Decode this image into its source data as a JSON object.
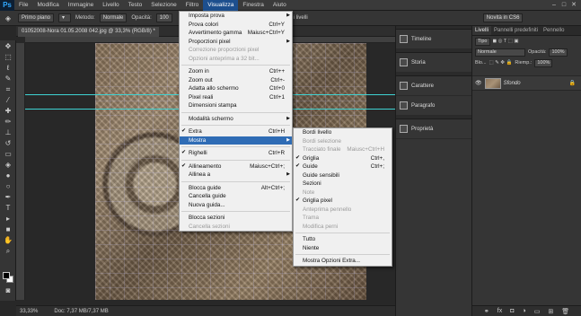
{
  "menubar": {
    "logo": "Ps",
    "items": [
      "File",
      "Modifica",
      "Immagine",
      "Livello",
      "Testo",
      "Selezione",
      "Filtro",
      "Visualizza",
      "Finestra",
      "Aiuto"
    ]
  },
  "optionsbar": {
    "preset": "Primo piano",
    "mode_label": "Metodo:",
    "mode_value": "Normale",
    "opacity_label": "Opacità:",
    "opacity_value": "100",
    "all_layers": "i livelli",
    "workspace": "Novità in CS6"
  },
  "document": {
    "tab_title": "01052008-Nora 01.05.2008 042.jpg @ 33,3% (RGB/8) *"
  },
  "statusbar": {
    "zoom": "33,33%",
    "doc_info": "Doc: 7,37 MB/7,37 MB"
  },
  "collapsed_panels": [
    "Timeline",
    "Storia",
    "Carattere",
    "Paragrafo",
    "Proprietà"
  ],
  "layers_panel": {
    "tabs": [
      "Livelli",
      "Pannelli predefiniti",
      "Pennello"
    ],
    "kind_label": "Tipo",
    "blend_mode": "Normale",
    "opacity_label": "Opacità:",
    "opacity_value": "100%",
    "lock_label": "Blo...",
    "fill_label": "Riemp.:",
    "fill_value": "100%",
    "layer_name": "Sfondo"
  },
  "visualizza_menu": {
    "items": [
      {
        "label": "Imposta prova",
        "shortcut": "",
        "submenu": true,
        "disabled": false
      },
      {
        "label": "Prova colori",
        "shortcut": "Ctrl+Y",
        "submenu": false,
        "disabled": false
      },
      {
        "label": "Avvertimento gamma",
        "shortcut": "Maiusc+Ctrl+Y",
        "submenu": false,
        "disabled": false
      },
      {
        "label": "Proporzioni pixel",
        "shortcut": "",
        "submenu": true,
        "disabled": false
      },
      {
        "label": "Correzione proporzioni pixel",
        "shortcut": "",
        "submenu": false,
        "disabled": true
      },
      {
        "label": "Opzioni anteprima a 32 bit...",
        "shortcut": "",
        "submenu": false,
        "disabled": true
      },
      {
        "sep": true
      },
      {
        "label": "Zoom in",
        "shortcut": "Ctrl++",
        "submenu": false,
        "disabled": false
      },
      {
        "label": "Zoom out",
        "shortcut": "Ctrl+-",
        "submenu": false,
        "disabled": false
      },
      {
        "label": "Adatta allo schermo",
        "shortcut": "Ctrl+0",
        "submenu": false,
        "disabled": false
      },
      {
        "label": "Pixel reali",
        "shortcut": "Ctrl+1",
        "submenu": false,
        "disabled": false
      },
      {
        "label": "Dimensioni stampa",
        "shortcut": "",
        "submenu": false,
        "disabled": false
      },
      {
        "sep": true
      },
      {
        "label": "Modalità schermo",
        "shortcut": "",
        "submenu": true,
        "disabled": false
      },
      {
        "sep": true
      },
      {
        "label": "Extra",
        "shortcut": "Ctrl+H",
        "submenu": false,
        "disabled": false,
        "checked": true
      },
      {
        "label": "Mostra",
        "shortcut": "",
        "submenu": true,
        "disabled": false,
        "highlight": true
      },
      {
        "sep": true
      },
      {
        "label": "Righelli",
        "shortcut": "Ctrl+R",
        "submenu": false,
        "disabled": false,
        "checked": true
      },
      {
        "sep": true
      },
      {
        "label": "Allineamento",
        "shortcut": "Maiusc+Ctrl+;",
        "submenu": false,
        "disabled": false,
        "checked": true
      },
      {
        "label": "Allinea a",
        "shortcut": "",
        "submenu": true,
        "disabled": false
      },
      {
        "sep": true
      },
      {
        "label": "Blocca guide",
        "shortcut": "Alt+Ctrl+;",
        "submenu": false,
        "disabled": false
      },
      {
        "label": "Cancella guide",
        "shortcut": "",
        "submenu": false,
        "disabled": false
      },
      {
        "label": "Nuova guida...",
        "shortcut": "",
        "submenu": false,
        "disabled": false
      },
      {
        "sep": true
      },
      {
        "label": "Blocca sezioni",
        "shortcut": "",
        "submenu": false,
        "disabled": false
      },
      {
        "label": "Cancella sezioni",
        "shortcut": "",
        "submenu": false,
        "disabled": true
      }
    ]
  },
  "mostra_submenu": {
    "items": [
      {
        "label": "Bordi livello",
        "shortcut": "",
        "disabled": false
      },
      {
        "label": "Bordi selezione",
        "shortcut": "",
        "disabled": true
      },
      {
        "label": "Tracciato finale",
        "shortcut": "Maiusc+Ctrl+H",
        "disabled": true
      },
      {
        "label": "Griglia",
        "shortcut": "Ctrl+,",
        "disabled": false,
        "checked": true
      },
      {
        "label": "Guide",
        "shortcut": "Ctrl+;",
        "disabled": false,
        "checked": true
      },
      {
        "label": "Guide sensibili",
        "shortcut": "",
        "disabled": false
      },
      {
        "label": "Sezioni",
        "shortcut": "",
        "disabled": false
      },
      {
        "label": "Note",
        "shortcut": "",
        "disabled": true
      },
      {
        "label": "Griglia pixel",
        "shortcut": "",
        "disabled": false,
        "checked": true
      },
      {
        "label": "Anteprima pennello",
        "shortcut": "",
        "disabled": true
      },
      {
        "label": "Trama",
        "shortcut": "",
        "disabled": true
      },
      {
        "label": "Modifica perni",
        "shortcut": "",
        "disabled": true
      },
      {
        "sep": true
      },
      {
        "label": "Tutto",
        "shortcut": "",
        "disabled": false
      },
      {
        "label": "Niente",
        "shortcut": "",
        "disabled": false
      },
      {
        "sep": true
      },
      {
        "label": "Mostra Opzioni Extra...",
        "shortcut": "",
        "disabled": false
      }
    ]
  },
  "colors": {
    "menu_highlight": "#2f6cb5",
    "guide": "#3ed3d3",
    "ui_dark": "#282828"
  }
}
